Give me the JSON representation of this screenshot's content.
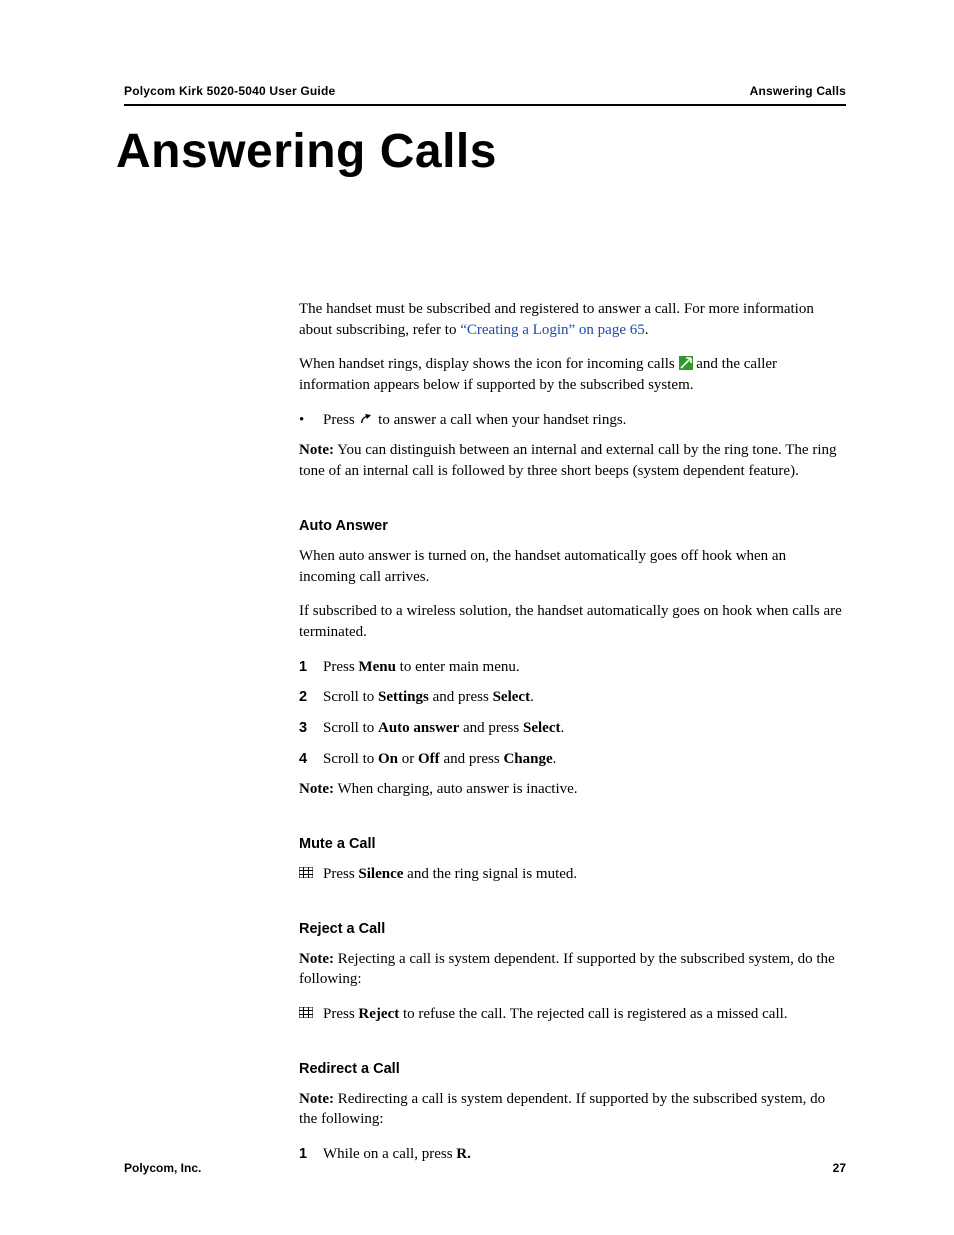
{
  "header": {
    "left": "Polycom Kirk 5020-5040 User Guide",
    "right": "Answering Calls"
  },
  "title": "Answering Calls",
  "intro": {
    "p1_a": "The handset must be subscribed and registered to answer a call. For more information about subscribing, refer to ",
    "p1_link": "“Creating a Login” on page 65",
    "p1_b": ".",
    "p2_a": "When handset rings, display shows the icon for incoming calls ",
    "p2_b": " and the caller information appears below if supported by the subscribed system.",
    "bullet_a": "Press ",
    "bullet_b": " to answer a call when your handset rings.",
    "note_label": "Note:",
    "note": " You can distinguish between an internal and external call by the ring tone. The ring tone of an internal call is followed by three short beeps (system dependent feature)."
  },
  "auto_answer": {
    "heading": "Auto Answer",
    "p1": "When auto answer is turned on, the handset automatically goes off hook when an incoming call arrives.",
    "p2": "If subscribed to a wireless solution, the handset automatically goes on hook when calls are terminated.",
    "steps": [
      {
        "n": "1",
        "pre": "Press ",
        "b1": "Menu",
        "mid": " to enter main menu."
      },
      {
        "n": "2",
        "pre": "Scroll to ",
        "b1": "Settings",
        "mid": " and press ",
        "b2": "Select",
        "post": "."
      },
      {
        "n": "3",
        "pre": "Scroll to ",
        "b1": "Auto answer",
        "mid": " and press ",
        "b2": "Select",
        "post": "."
      },
      {
        "n": "4",
        "pre": "Scroll to ",
        "b1": "On",
        "mid": " or ",
        "b2": "Off",
        "mid2": " and press ",
        "b3": "Change",
        "post": "."
      }
    ],
    "note_label": "Note:",
    "note": " When charging, auto answer is inactive."
  },
  "mute": {
    "heading": "Mute a Call",
    "pre": "Press ",
    "b1": "Silence",
    "post": " and the ring signal is muted."
  },
  "reject": {
    "heading": "Reject a Call",
    "note_label": "Note:",
    "note": " Rejecting a call is system dependent. If supported by the subscribed system, do the following:",
    "pre": "Press ",
    "b1": "Reject",
    "post": " to refuse the call. The rejected call is registered as a missed call."
  },
  "redirect": {
    "heading": "Redirect a Call",
    "note_label": "Note:",
    "note": " Redirecting a call is system dependent. If supported by the subscribed system, do the following:",
    "step1_n": "1",
    "step1_pre": "While on a call, press ",
    "step1_b": "R."
  },
  "footer": {
    "left": "Polycom, Inc.",
    "right": "27"
  }
}
